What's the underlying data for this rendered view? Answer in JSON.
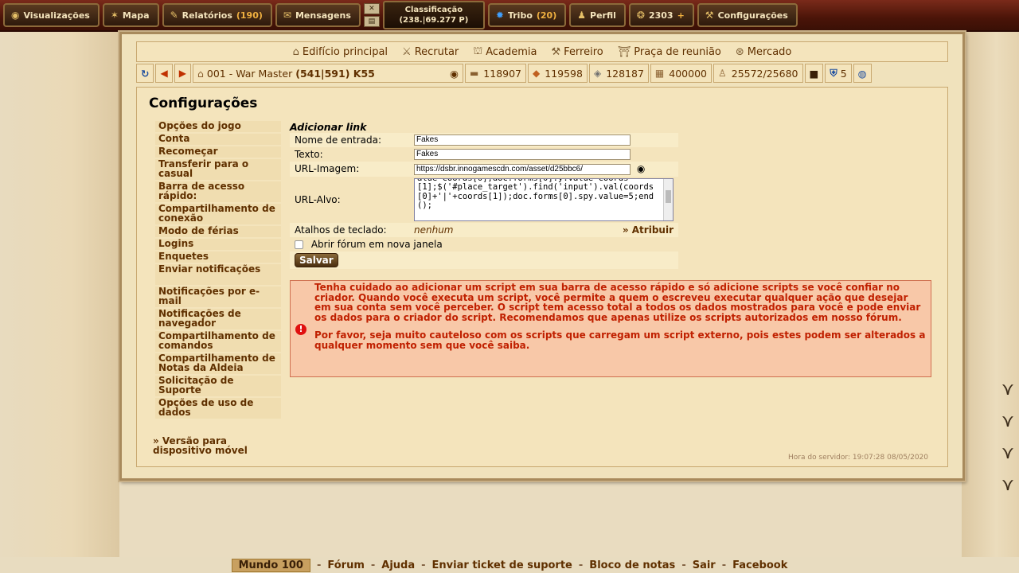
{
  "topbar": {
    "visualizacoes": "Visualizações",
    "mapa": "Mapa",
    "relatorios": "Relatórios",
    "relatorios_count": "(190)",
    "mensagens": "Mensagens",
    "classificacao_title": "Classificação",
    "classificacao_value": "(238.|69.277 P)",
    "tribo": "Tribo",
    "tribo_count": "(20)",
    "perfil": "Perfil",
    "premium_points": "2303",
    "configuracoes": "Configurações"
  },
  "buildings": {
    "edificio": "Edifício principal",
    "recrutar": "Recrutar",
    "academia": "Academia",
    "ferreiro": "Ferreiro",
    "praca": "Praça de reunião",
    "mercado": "Mercado"
  },
  "village": {
    "name": "001 - War Master",
    "coords": "(541|591) K55",
    "wood": "118907",
    "clay": "119598",
    "iron": "128187",
    "storage": "400000",
    "farm": "25572/25680",
    "units_count": "5"
  },
  "page": {
    "title": "Configurações",
    "menu": [
      "Opções do jogo",
      "Conta",
      "Recomeçar",
      "Transferir para o casual",
      "Barra de acesso rápido:",
      "Compartilhamento de conexão",
      "Modo de férias",
      "Logins",
      "Enquetes",
      "Enviar notificações",
      "Notificações por e-mail",
      "Notificações de navegador",
      "Compartilhamento de comandos",
      "Compartilhamento de Notas da Aldeia",
      "Solicitação de Suporte",
      "Opções de uso de dados"
    ],
    "mobile_link": "» Versão para dispositivo móvel"
  },
  "form": {
    "title": "Adicionar link",
    "entry_label": "Nome de entrada:",
    "entry_value": "Fakes",
    "text_label": "Texto:",
    "text_value": "Fakes",
    "image_label": "URL-Imagem:",
    "image_value": "https://dsbr.innogamescdn.com/asset/d25bbc6/",
    "target_label": "URL-Alvo:",
    "target_value": "alue=coords[0];doc.forms[0].y.value=coords[1];$('#place_target').find('input').val(coords[0]+'|'+coords[1]);doc.forms[0].spy.value=5;end();",
    "shortcut_label": "Atalhos de teclado:",
    "shortcut_value": "nenhum",
    "assign": "» Atribuir",
    "forum_label": "Abrir fórum em nova janela",
    "save": "Salvar"
  },
  "warning": {
    "p1": "Tenha cuidado ao adicionar um script em sua barra de acesso rápido e só adicione scripts se você confiar no criador. Quando você executa um script, você permite a quem o escreveu executar qualquer ação que desejar em sua conta sem você perceber. O script tem acesso total a todos os dados mostrados para você e pode enviar os dados para o criador do script. Recomendamos que apenas utilize os scripts autorizados em nosso fórum.",
    "p2": "Por favor, seja muito cauteloso com os scripts que carregam um script externo, pois estes podem ser alterados a qualquer momento sem que você saiba."
  },
  "server_time": "Hora do servidor: 19:07:28 08/05/2020",
  "footer": {
    "world": "Mundo 100",
    "links": [
      "Fórum",
      "Ajuda",
      "Enviar ticket de suporte",
      "Bloco de notas",
      "Sair",
      "Facebook"
    ]
  }
}
